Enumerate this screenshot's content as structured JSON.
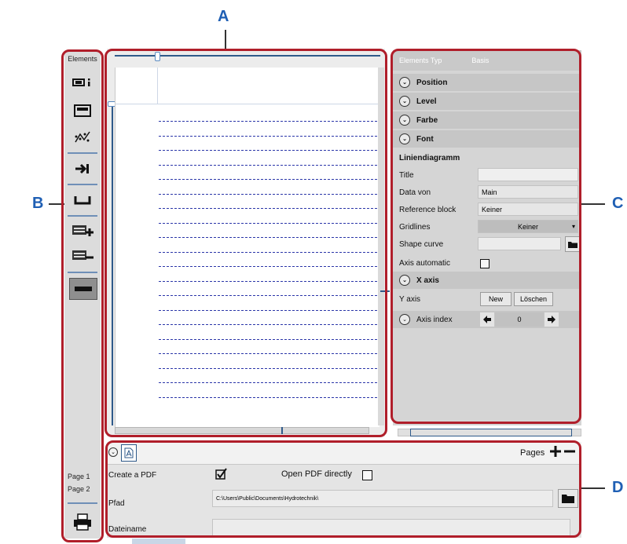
{
  "callouts": {
    "a": "A",
    "b": "B",
    "c": "C",
    "d": "D"
  },
  "toolbar": {
    "title": "Elements",
    "page1": "Page  1",
    "page2": "Page  2"
  },
  "panel": {
    "header_left": "Elements Typ",
    "header_right": "Basis",
    "sections": [
      "Position",
      "Level",
      "Farbe",
      "Font"
    ],
    "group_title": "Liniendiagramm",
    "title_label": "Title",
    "data_label": "Data von",
    "data_value": "Main",
    "ref_label": "Reference block",
    "ref_value": "Keiner",
    "grid_label": "Gridlines",
    "grid_value": "Keiner",
    "shape_label": "Shape curve",
    "axis_auto_label": "Axis automatic",
    "xaxis": "X axis",
    "yaxis_label": "Y axis",
    "new_btn": "New",
    "delete_btn": "Löschen",
    "axis_index_label": "Axis index",
    "axis_index_value": "0"
  },
  "bottom": {
    "pages_label": "Pages",
    "create_pdf": "Create a PDF",
    "open_pdf": "Open PDF directly",
    "path_label": "Pfad",
    "path_value": "C:\\Users\\Public\\Documents\\Hydrotechnik\\",
    "filename_label": "Dateiname"
  },
  "colors": {
    "callout": "#1f5fb4",
    "frame": "#b01e2a",
    "dash": "#2a35a8",
    "ruler": "#2f5a8a"
  }
}
